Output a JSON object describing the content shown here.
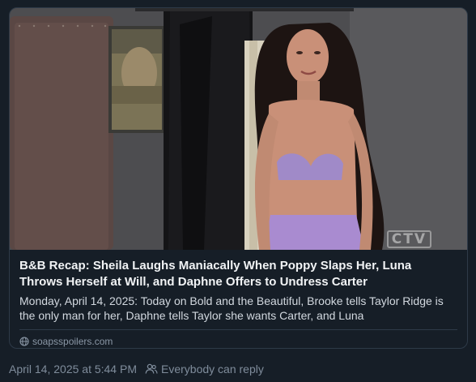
{
  "link_card": {
    "image": {
      "alt_icon": "video-still-image",
      "watermark": "CTV"
    },
    "title": "B&B Recap: Sheila Laughs Maniacally When Poppy Slaps Her, Luna Throws Herself at Will, and Daphne Offers to Undress Carter",
    "description": "Monday, April 14, 2025: Today on Bold and the Beautiful, Brooke tells Taylor Ridge is the only man for her, Daphne tells Taylor she wants Carter, and Luna",
    "domain": "soapsspoilers.com",
    "domain_icon": "globe-icon"
  },
  "post_meta": {
    "timestamp": "April 14, 2025 at 5:44 PM",
    "reply_setting": "Everybody can reply",
    "reply_icon": "people-icon"
  },
  "colors": {
    "background": "#161e27",
    "card_border": "#2e3a48",
    "title_text": "#f1f3f5",
    "muted_text": "#7f8c9b"
  }
}
